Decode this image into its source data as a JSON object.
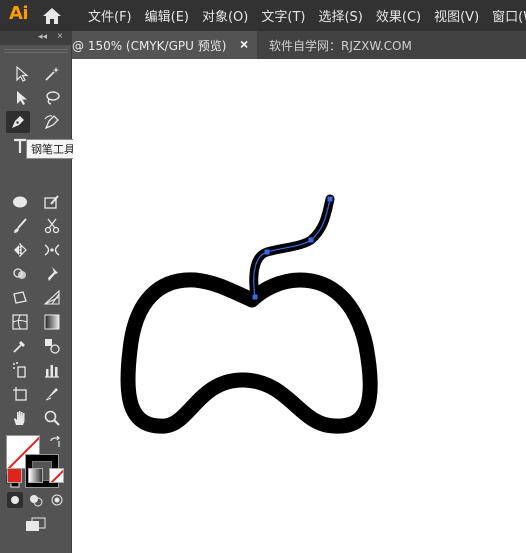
{
  "app": {
    "logo": "Ai"
  },
  "menu": {
    "items": [
      "文件(F)",
      "编辑(E)",
      "对象(O)",
      "文字(T)",
      "选择(S)",
      "效果(C)",
      "视图(V)",
      "窗口(W)"
    ]
  },
  "tabs": {
    "active": "@ 150% (CMYK/GPU 预览)",
    "close": "×",
    "other": "软件自学网：RJZXW.COM"
  },
  "toolbar": {
    "collapse": "◂◂",
    "close": "×"
  },
  "tooltip": "钢笔工具 (P)",
  "colors": {
    "menubar": "#323232",
    "toolbar": "#535353",
    "accent": "#ff9a00",
    "anchor": "#3b6be0"
  }
}
